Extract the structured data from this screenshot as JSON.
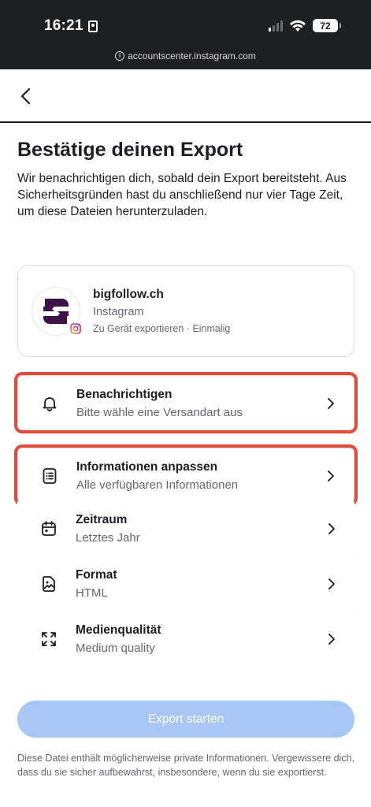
{
  "status_bar": {
    "time": "16:21",
    "battery": "72",
    "url": "accountscenter.instagram.com"
  },
  "header": {
    "title": "Bestätige deinen Export",
    "description": "Wir benachrichtigen dich, sobald dein Export bereitsteht. Aus Sicherheitsgründen hast du anschließend nur vier Tage Zeit, um diese Dateien herunterzuladen."
  },
  "account": {
    "name": "bigfollow.ch",
    "platform": "Instagram",
    "subtitle": "Zu Gerät exportieren · Einmalig",
    "brand_color": "#3b1346"
  },
  "options": [
    {
      "title": "Benachrichtigen",
      "subtitle": "Bitte wähle eine Versandart aus",
      "icon": "bell-icon"
    },
    {
      "title": "Informationen anpassen",
      "subtitle": "Alle verfügbaren Informationen",
      "icon": "document-list-icon"
    },
    {
      "title": "Zeitraum",
      "subtitle": "Letztes Jahr",
      "icon": "calendar-icon"
    },
    {
      "title": "Format",
      "subtitle": "HTML",
      "icon": "image-file-icon"
    },
    {
      "title": "Medienqualität",
      "subtitle": "Medium quality",
      "icon": "expand-icon"
    }
  ],
  "export_button": {
    "label": "Export starten",
    "color": "#a7c7f7"
  },
  "footer": {
    "text": "Diese Datei enthält möglicherweise private Informationen. Vergewissere dich, dass du sie sicher aufbewahrst, insbesondere, wenn du sie exportierst."
  },
  "colors": {
    "highlight": "#e34b3c",
    "text_primary": "#1c1e21",
    "text_secondary": "#65676b",
    "status_bar_bg": "#1e1f21"
  }
}
